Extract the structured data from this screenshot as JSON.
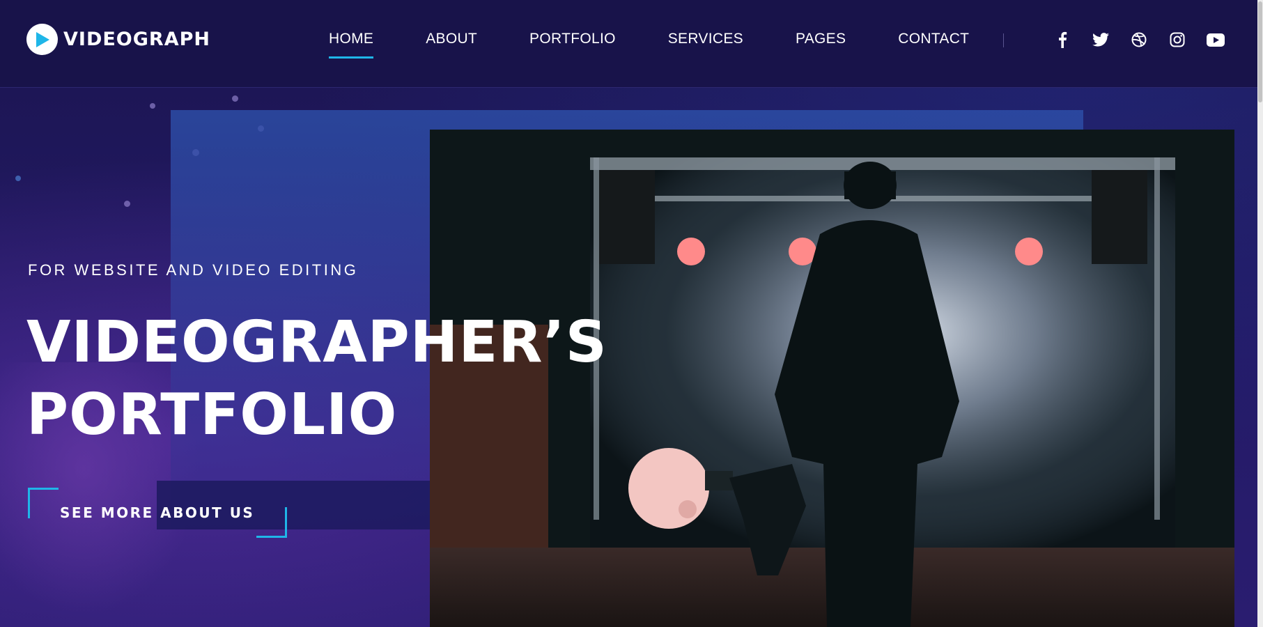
{
  "brand": {
    "name": "VIDEOGRAPH",
    "logo_icon": "play-circle-icon",
    "accent": "#1fb6e8"
  },
  "nav": {
    "items": [
      {
        "label": "HOME",
        "active": true
      },
      {
        "label": "ABOUT",
        "active": false
      },
      {
        "label": "PORTFOLIO",
        "active": false
      },
      {
        "label": "SERVICES",
        "active": false
      },
      {
        "label": "PAGES",
        "active": false
      },
      {
        "label": "CONTACT",
        "active": false
      }
    ]
  },
  "social": [
    "facebook-icon",
    "twitter-icon",
    "dribbble-icon",
    "instagram-icon",
    "youtube-icon"
  ],
  "hero": {
    "kicker": "FOR WEBSITE AND VIDEO EDITING",
    "title_line1": "VIDEOGRAPHER’S",
    "title_line2": "PORTFOLIO",
    "cta_label": "SEE MORE ABOUT US"
  }
}
